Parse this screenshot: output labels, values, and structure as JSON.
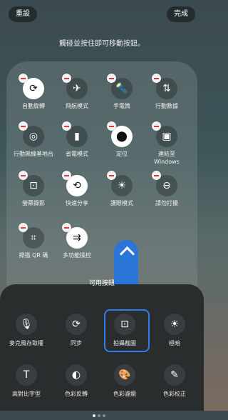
{
  "top": {
    "reset": "重設",
    "done": "完成"
  },
  "hint": "觸碰並按住即可移動按鈕。",
  "quick_tiles": [
    {
      "label": "自動旋轉",
      "icon": "rotate-icon",
      "glyph": "⟳",
      "style": "white"
    },
    {
      "label": "飛航模式",
      "icon": "airplane-icon",
      "glyph": "✈",
      "style": "dark"
    },
    {
      "label": "手電筒",
      "icon": "flashlight-icon",
      "glyph": "🔦",
      "style": "dark"
    },
    {
      "label": "行動數據",
      "icon": "mobile-data-icon",
      "glyph": "⇅",
      "style": "dark"
    },
    {
      "label": "行動無線基地台",
      "icon": "hotspot-icon",
      "glyph": "◎",
      "style": "dark"
    },
    {
      "label": "省電模式",
      "icon": "battery-saver-icon",
      "glyph": "▮",
      "style": "dark"
    },
    {
      "label": "定位",
      "icon": "location-icon",
      "glyph": "⬤",
      "style": "white"
    },
    {
      "label": "連結至\nWindows",
      "icon": "link-to-windows-icon",
      "glyph": "▣",
      "style": "dark"
    },
    {
      "label": "螢幕錄影",
      "icon": "screen-record-icon",
      "glyph": "⊡",
      "style": "dark"
    },
    {
      "label": "快速分享",
      "icon": "quick-share-icon",
      "glyph": "⟲",
      "style": "white"
    },
    {
      "label": "護眼模式",
      "icon": "eye-comfort-icon",
      "glyph": "☀",
      "style": "dark"
    },
    {
      "label": "請勿打擾",
      "icon": "do-not-disturb-icon",
      "glyph": "⊖",
      "style": "dark"
    },
    {
      "label": "掃描 QR 碼",
      "icon": "qr-scan-icon",
      "glyph": "⌗",
      "style": "dark"
    },
    {
      "label": "多功能操控",
      "icon": "multi-control-icon",
      "glyph": "⇉",
      "style": "white"
    }
  ],
  "sheet": {
    "title": "可用按鈕",
    "buttons": [
      {
        "label": "麥克風存取權",
        "icon": "microphone-icon",
        "glyph": "🎙"
      },
      {
        "label": "同步",
        "icon": "sync-icon",
        "glyph": "⟳"
      },
      {
        "label": "拍攝截圖",
        "icon": "screenshot-icon",
        "glyph": "⊡"
      },
      {
        "label": "極暗",
        "icon": "extra-dim-icon",
        "glyph": "☀"
      },
      {
        "label": "高對比字型",
        "icon": "high-contrast-font-icon",
        "glyph": "T"
      },
      {
        "label": "色彩反轉",
        "icon": "color-inversion-icon",
        "glyph": "◐"
      },
      {
        "label": "色彩濾鏡",
        "icon": "color-filter-icon",
        "glyph": "🎨"
      },
      {
        "label": "色彩校正",
        "icon": "color-correction-icon",
        "glyph": "✎"
      }
    ]
  }
}
